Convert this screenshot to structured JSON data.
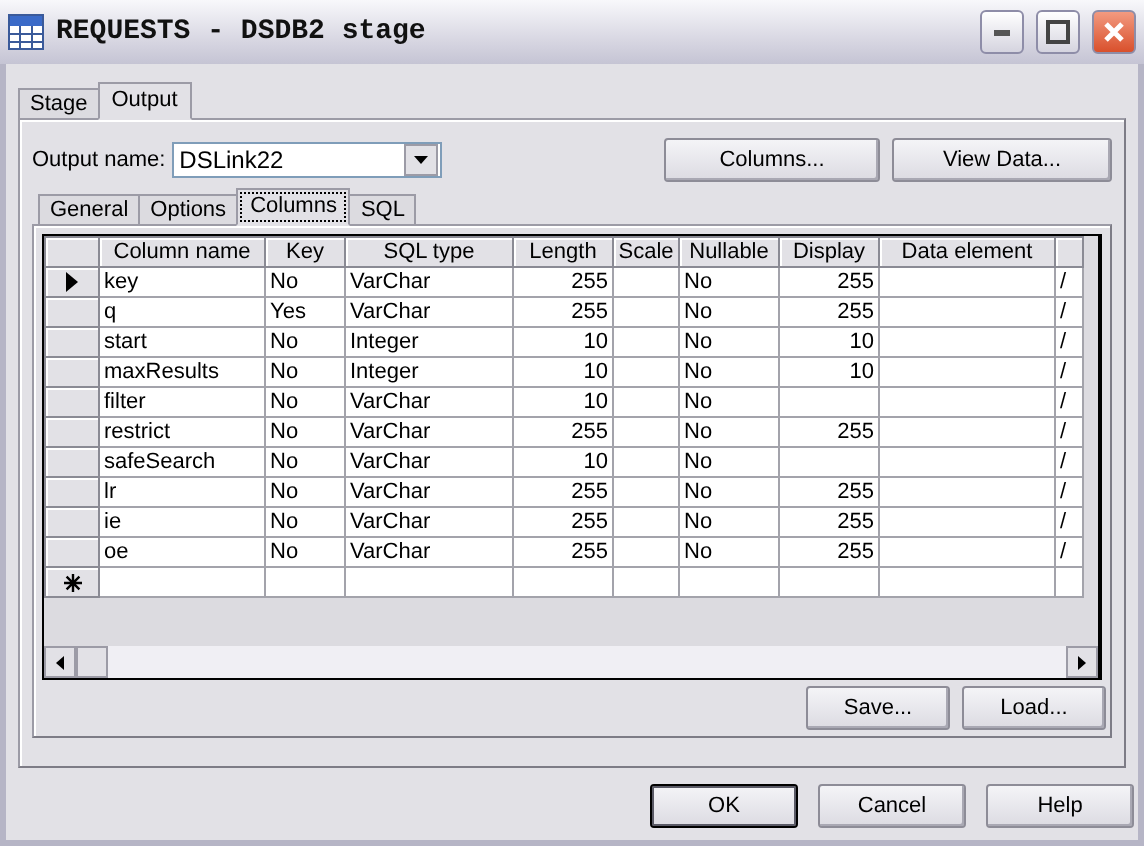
{
  "window": {
    "title": "REQUESTS - DSDB2 stage"
  },
  "outer_tabs": [
    {
      "label": "Stage",
      "selected": false
    },
    {
      "label": "Output",
      "selected": true
    }
  ],
  "output_name": {
    "label": "Output name:",
    "value": "DSLink22"
  },
  "top_buttons": [
    "Columns...",
    "View Data..."
  ],
  "inner_tabs": [
    {
      "label": "General",
      "selected": false
    },
    {
      "label": "Options",
      "selected": false
    },
    {
      "label": "Columns",
      "selected": true
    },
    {
      "label": "SQL",
      "selected": false
    }
  ],
  "table": {
    "columns": [
      "Column name",
      "Key",
      "SQL type",
      "Length",
      "Scale",
      "Nullable",
      "Display",
      "Data element"
    ],
    "rows": [
      {
        "current": true,
        "cells": [
          "key",
          "No",
          "VarChar",
          "255",
          "",
          "No",
          "255",
          "",
          "/"
        ]
      },
      {
        "current": false,
        "cells": [
          "q",
          "Yes",
          "VarChar",
          "255",
          "",
          "No",
          "255",
          "",
          "/"
        ]
      },
      {
        "current": false,
        "cells": [
          "start",
          "No",
          "Integer",
          "10",
          "",
          "No",
          "10",
          "",
          "/"
        ]
      },
      {
        "current": false,
        "cells": [
          "maxResults",
          "No",
          "Integer",
          "10",
          "",
          "No",
          "10",
          "",
          "/"
        ]
      },
      {
        "current": false,
        "cells": [
          "filter",
          "No",
          "VarChar",
          "10",
          "",
          "No",
          "",
          "",
          "/"
        ]
      },
      {
        "current": false,
        "cells": [
          "restrict",
          "No",
          "VarChar",
          "255",
          "",
          "No",
          "255",
          "",
          "/"
        ]
      },
      {
        "current": false,
        "cells": [
          "safeSearch",
          "No",
          "VarChar",
          "10",
          "",
          "No",
          "",
          "",
          "/"
        ]
      },
      {
        "current": false,
        "cells": [
          "lr",
          "No",
          "VarChar",
          "255",
          "",
          "No",
          "255",
          "",
          "/"
        ]
      },
      {
        "current": false,
        "cells": [
          "ie",
          "No",
          "VarChar",
          "255",
          "",
          "No",
          "255",
          "",
          "/"
        ]
      },
      {
        "current": false,
        "cells": [
          "oe",
          "No",
          "VarChar",
          "255",
          "",
          "No",
          "255",
          "",
          "/"
        ]
      }
    ]
  },
  "grid_buttons": [
    "Save...",
    "Load..."
  ],
  "dialog_buttons": [
    {
      "label": "OK",
      "default": true
    },
    {
      "label": "Cancel",
      "default": false
    },
    {
      "label": "Help",
      "default": false
    }
  ]
}
